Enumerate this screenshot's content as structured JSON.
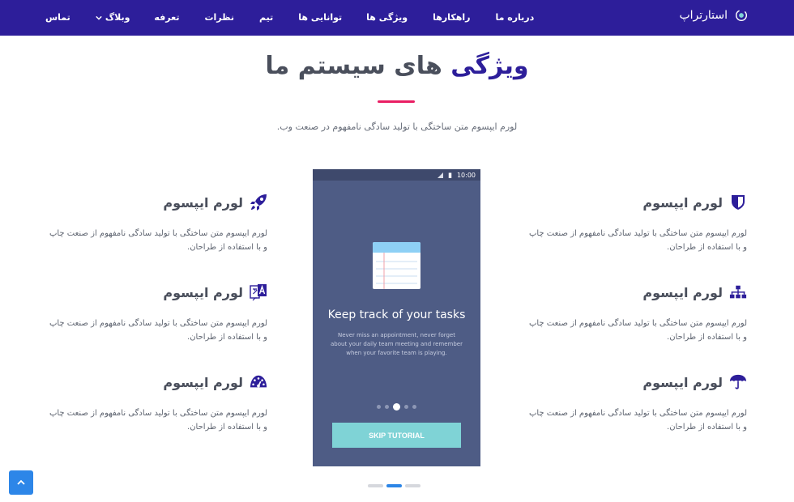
{
  "nav": {
    "brand": "استارتراپ",
    "items": [
      {
        "key": "contact",
        "label": "تماس"
      },
      {
        "key": "blog",
        "label": "وبلاگ",
        "caret": true
      },
      {
        "key": "pricing",
        "label": "تعرفه"
      },
      {
        "key": "reviews",
        "label": "نظرات"
      },
      {
        "key": "team",
        "label": "تیم"
      },
      {
        "key": "capabilities",
        "label": "توانایی ها"
      },
      {
        "key": "features",
        "label": "ویژگی ها"
      },
      {
        "key": "solutions",
        "label": "راهکارها"
      },
      {
        "key": "about",
        "label": "درباره ما"
      }
    ]
  },
  "section": {
    "title_accent": "ویژگی",
    "title_rest": " های سیستم ما",
    "subtitle": "لورم ایپسوم متن ساختگی با تولید سادگی نامفهوم در صنعت وب."
  },
  "features": [
    {
      "title": "لورم ایپسوم",
      "icon": "shield-icon",
      "text": "لورم ایپسوم متن ساختگی با تولید سادگی نامفهوم از صنعت چاپ و با استفاده از طراحان."
    },
    {
      "title": "لورم ایپسوم",
      "icon": "sitemap-icon",
      "text": "لورم ایپسوم متن ساختگی با تولید سادگی نامفهوم از صنعت چاپ و با استفاده از طراحان."
    },
    {
      "title": "لورم ایپسوم",
      "icon": "umbrella-icon",
      "text": "لورم ایپسوم متن ساختگی با تولید سادگی نامفهوم از صنعت چاپ و با استفاده از طراحان."
    },
    {
      "title": "لورم ایپسوم",
      "icon": "rocket-icon",
      "text": "لورم ایپسوم متن ساختگی با تولید سادگی نامفهوم از صنعت چاپ و با استفاده از طراحان."
    },
    {
      "title": "لورم ایپسوم",
      "icon": "language-icon",
      "text": "لورم ایپسوم متن ساختگی با تولید سادگی نامفهوم از صنعت چاپ و با استفاده از طراحان."
    },
    {
      "title": "لورم ایپسوم",
      "icon": "dashboard-icon",
      "text": "لورم ایپسوم متن ساختگی با تولید سادگی نامفهوم از صنعت چاپ و با استفاده از طراحان."
    }
  ],
  "phone": {
    "time": "10:00",
    "title": "Keep track of your tasks",
    "description": "Never miss an appointment, never forget about your daily team meeting and remember when your favorite team is playing.",
    "skip_label": "SKIP TUTORIAL",
    "slide_count": 5,
    "active_slide": 3
  },
  "carousel": {
    "count": 3,
    "active": 2
  },
  "colors": {
    "navbar": "#2d1e9a",
    "accent": "#2d1e9a",
    "rule": "#e91e63",
    "phone_bg": "#4e5c85",
    "skip_button": "#7fd3d6",
    "back_to_top": "#2d86e8"
  }
}
